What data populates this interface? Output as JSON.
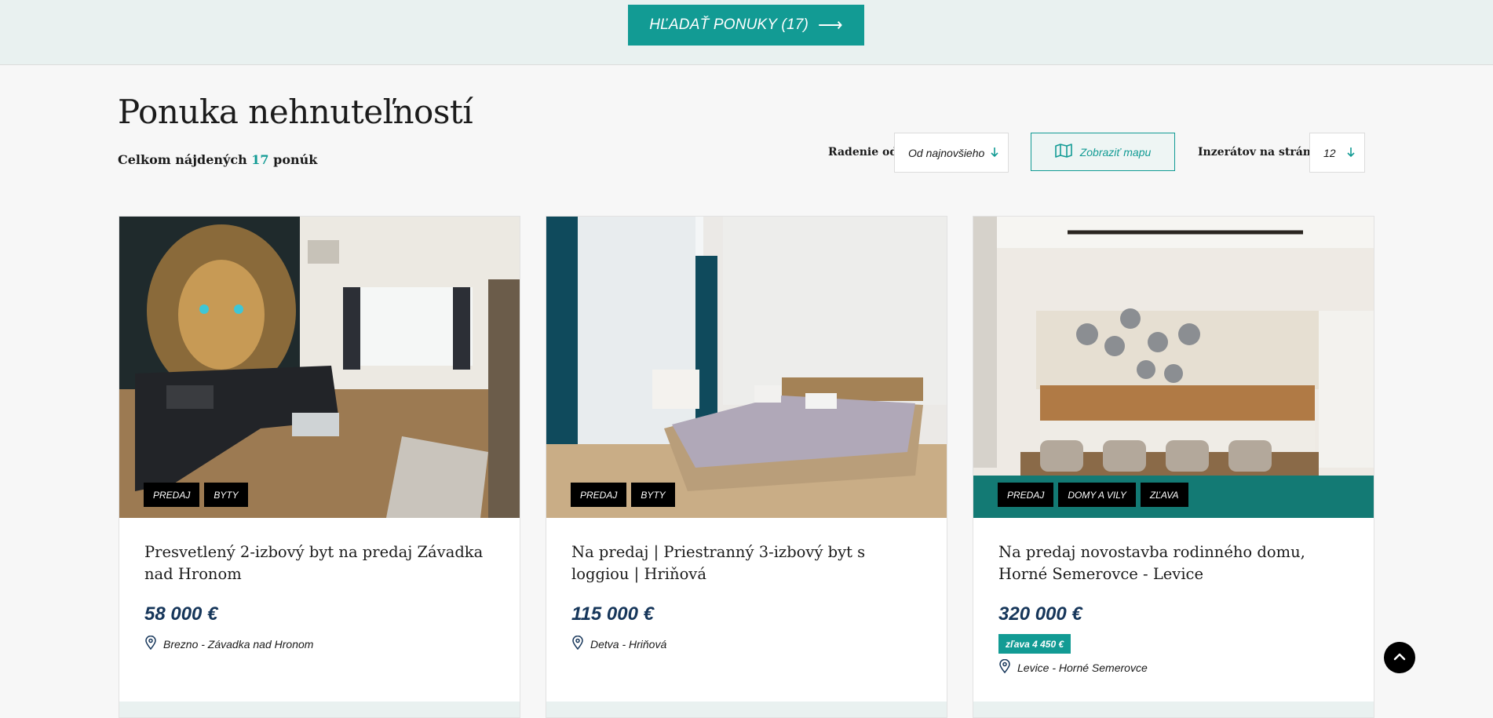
{
  "search": {
    "button_label": "HĽADAŤ PONUKY (17)",
    "arrow": "⟶"
  },
  "page": {
    "title": "Ponuka nehnuteľností",
    "count_prefix": "Celkom nájdených",
    "count_value": "17",
    "count_suffix": "ponúk"
  },
  "controls": {
    "sort_label": "Radenie od:",
    "sort_value": "Od najnovšieho",
    "map_button": "Zobraziť mapu",
    "per_page_label": "Inzerátov na stránke",
    "per_page_value": "12"
  },
  "listings": [
    {
      "tags": [
        "PREDAJ",
        "BYTY"
      ],
      "title": "Presvetlený 2-izbový byt na predaj Závadka nad Hronom",
      "price": "58 000 €",
      "discount": null,
      "location": "Brezno - Závadka nad Hronom"
    },
    {
      "tags": [
        "PREDAJ",
        "BYTY"
      ],
      "title": "Na predaj | Priestranný 3-izbový byt s loggiou | Hriňová",
      "price": "115 000 €",
      "discount": null,
      "location": "Detva - Hriňová"
    },
    {
      "tags": [
        "PREDAJ",
        "DOMY A VILY",
        "ZĽAVA"
      ],
      "title": "Na predaj novostavba rodinného domu, Horné Semerovce - Levice",
      "price": "320 000 €",
      "discount": "zľava 4 450 €",
      "location": "Levice - Horné Semerovce"
    }
  ],
  "colors": {
    "accent": "#129b94",
    "price": "#16365a",
    "topbar": "#e9f1f0"
  },
  "icons": {
    "map": "map-icon",
    "location": "location-pin-icon",
    "sort": "arrow-down-icon",
    "scroll_top": "chevron-up-icon"
  }
}
